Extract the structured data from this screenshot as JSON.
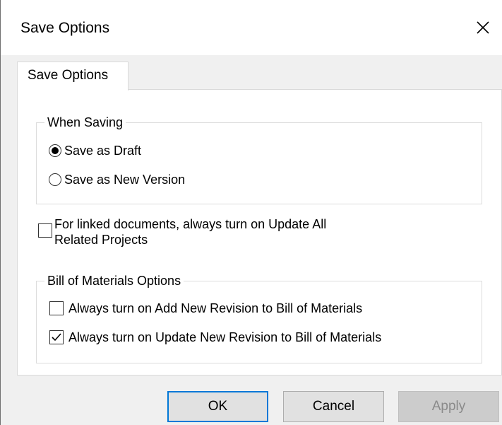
{
  "window": {
    "title": "Save Options",
    "close_icon": "close-icon"
  },
  "tabs": [
    {
      "label": "Save Options",
      "selected": true
    }
  ],
  "when_saving": {
    "legend": "When Saving",
    "options": [
      {
        "label": "Save as Draft",
        "selected": true
      },
      {
        "label": "Save as New Version",
        "selected": false
      }
    ]
  },
  "linked_docs": {
    "label_line1": "For linked documents, always turn on Update All",
    "label_line2": "Related Projects",
    "checked": false
  },
  "bom": {
    "legend": "Bill of Materials Options",
    "options": [
      {
        "label": "Always turn on Add New Revision to Bill of Materials",
        "checked": false
      },
      {
        "label": "Always turn on Update New Revision to Bill of Materials",
        "checked": true
      }
    ]
  },
  "buttons": {
    "ok": "OK",
    "cancel": "Cancel",
    "apply": "Apply"
  },
  "colors": {
    "default_button_border": "#0078d7",
    "dialog_background": "#f0f0f0",
    "disabled_text": "#8a8a8a"
  }
}
